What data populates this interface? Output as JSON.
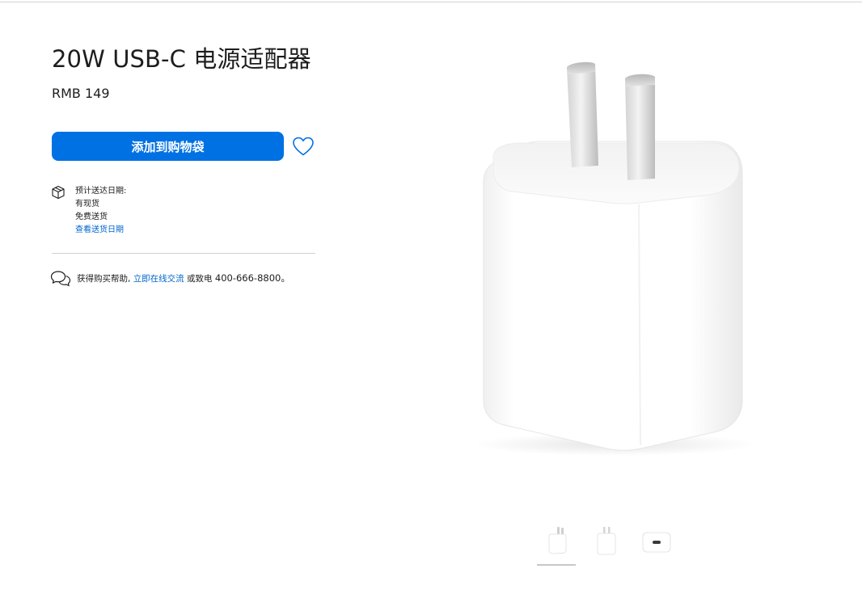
{
  "product": {
    "title": "20W USB-C 电源适配器",
    "price": "RMB 149"
  },
  "actions": {
    "add_to_bag_label": "添加到购物袋",
    "favorite_icon": "heart-icon"
  },
  "delivery": {
    "icon": "package-box-icon",
    "heading": "预计送达日期:",
    "availability": "有现货",
    "shipping": "免费送货",
    "check_link": "查看送货日期"
  },
  "help": {
    "icon": "chat-bubbles-icon",
    "prefix": "获得购买帮助,",
    "chat_link": "立即在线交流",
    "or_call": "或致电",
    "phone": "400-666-8800。"
  },
  "gallery": {
    "hero_image": "charger-front-view",
    "thumbnails": [
      "charger-front-view",
      "charger-side-view",
      "charger-usb-c-port-view"
    ],
    "active_index": 0
  },
  "colors": {
    "accent": "#0071e3",
    "link": "#0066cc",
    "text": "#1d1d1f",
    "divider": "#d2d2d7"
  }
}
